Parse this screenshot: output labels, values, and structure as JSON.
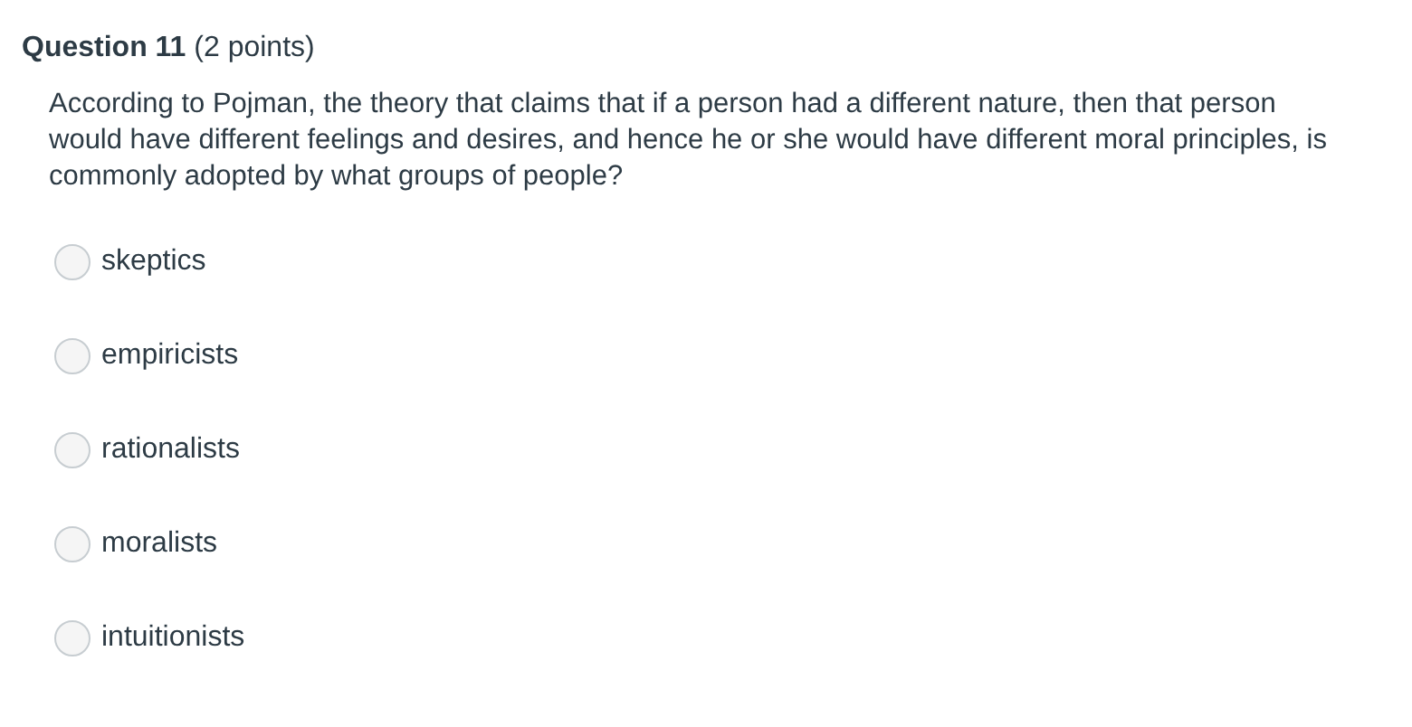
{
  "question": {
    "title": "**Question 11** (2 points)",
    "text": "According to Pojman, the theory that claims that if a person had a different nature, then that person would have different feelings and desires, and hence he or she would have different moral principles, is commonly adopted by what groups of people?"
  },
  "options": [
    {
      "label": "skeptics",
      "selected": false
    },
    {
      "label": "empiricists",
      "selected": false
    },
    {
      "label": "rationalists",
      "selected": false
    },
    {
      "label": "moralists",
      "selected": false
    },
    {
      "label": "intuitionists",
      "selected": false
    }
  ]
}
